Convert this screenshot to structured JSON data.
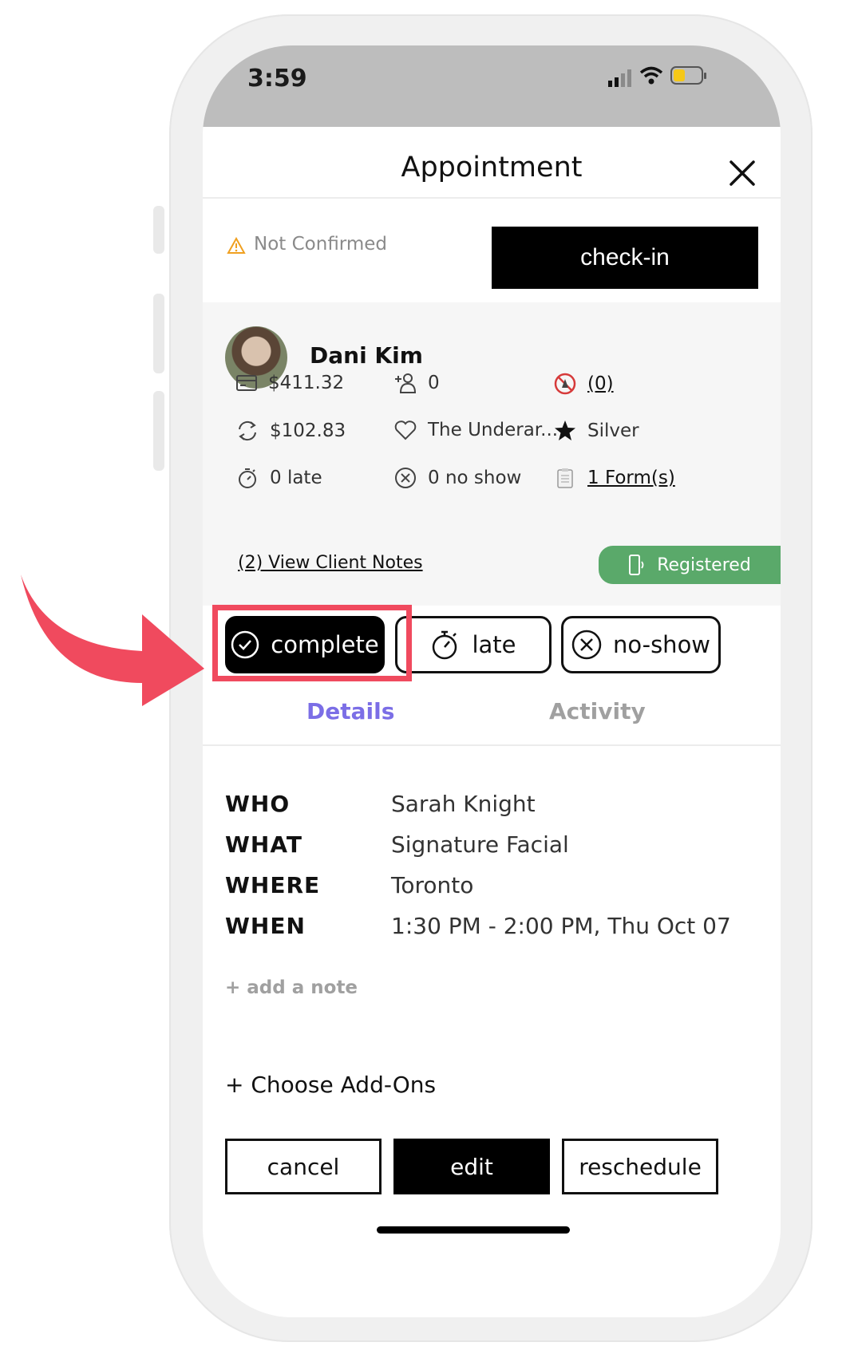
{
  "status_bar": {
    "time": "3:59"
  },
  "header": {
    "title": "Appointment"
  },
  "confirmation": {
    "status": "Not Confirmed",
    "checkin_label": "check-in"
  },
  "client": {
    "name": "Dani Kim",
    "stats": {
      "balance": "$411.32",
      "referrals": "0",
      "alerts": "(0)",
      "recurring": "$102.83",
      "favorite": "The Underar...",
      "tier": "Silver",
      "late": "0 late",
      "no_show": "0 no show",
      "forms": "1 Form(s)"
    },
    "notes_link": "(2) View Client Notes",
    "registered": "Registered"
  },
  "actions": {
    "complete": "complete",
    "late": "late",
    "no_show": "no-show"
  },
  "tabs": [
    {
      "label": "Details"
    },
    {
      "label": "Activity"
    }
  ],
  "details": [
    {
      "label": "WHO",
      "value": "Sarah Knight"
    },
    {
      "label": "WHAT",
      "value": "Signature Facial"
    },
    {
      "label": "WHERE",
      "value": "Toronto"
    },
    {
      "label": "WHEN",
      "value": "1:30 PM - 2:00 PM, Thu Oct 07"
    }
  ],
  "add_note": "+ add a note",
  "addons": "+ Choose Add-Ons",
  "footer": {
    "cancel": "cancel",
    "edit": "edit",
    "reschedule": "reschedule"
  },
  "colors": {
    "accent_tab": "#7b6ee6",
    "registered_green": "#5aa96a",
    "highlight_red": "#f04a5e",
    "warning_orange": "#f0a020"
  },
  "icons": [
    "card-icon",
    "referral-icon",
    "alert-icon",
    "recurring-icon",
    "heart-icon",
    "star-icon",
    "stopwatch-icon",
    "no-show-icon",
    "form-icon",
    "phone-icon",
    "check-circle-icon",
    "close-icon",
    "warning-icon",
    "arrow-icon"
  ]
}
